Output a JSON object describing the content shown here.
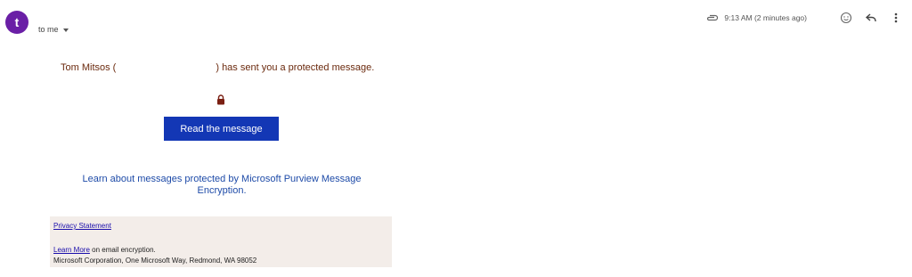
{
  "header": {
    "avatar_letter": "t",
    "recipient_label": "to me",
    "timestamp": "9:13 AM (2 minutes ago)"
  },
  "icons": {
    "attachment": "paperclip-icon",
    "emoji": "smiley-icon",
    "reply": "reply-arrow-icon",
    "more": "vertical-dots-icon",
    "lock": "lock-icon"
  },
  "message": {
    "sender_name": "Tom Mitsos (",
    "sender_suffix": ") has sent you a protected message.",
    "read_button_label": "Read the message",
    "learn_link_text": "Learn about messages protected by Microsoft Purview Message Encryption."
  },
  "footer": {
    "privacy_label": "Privacy Statement",
    "learn_more_label": "Learn More",
    "learn_more_suffix": " on email encryption.",
    "corporate_address": "Microsoft Corporation, One Microsoft Way, Redmond, WA 98052"
  },
  "colors": {
    "avatar_bg": "#6a1fa6",
    "button_bg": "#1337b5",
    "link_blue": "#1e4ba8",
    "sender_text": "#6b2a0e",
    "footer_bg": "#f3ede9"
  }
}
